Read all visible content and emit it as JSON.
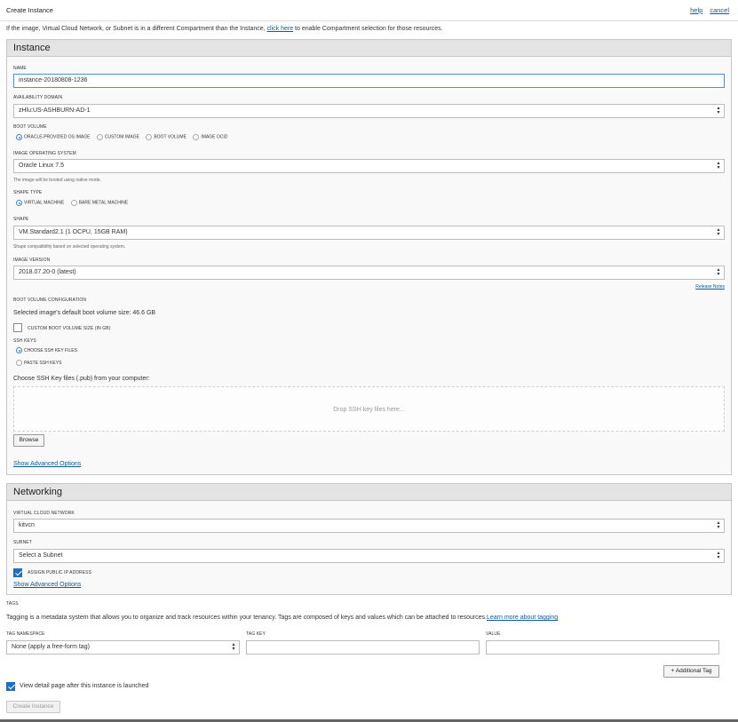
{
  "header": {
    "title": "Create Instance",
    "help_link": "help",
    "cancel_link": "cancel"
  },
  "notice": {
    "before": "If the image, Virtual Cloud Network, or Subnet is in a different Compartment than the Instance, ",
    "link": "click here",
    "after": " to enable Compartment selection for those resources."
  },
  "instance": {
    "heading": "Instance",
    "name_label": "NAME",
    "name_value": "instance-20180808-1236",
    "ad_label": "AVAILABILITY DOMAIN",
    "ad_value": "zHlu:US-ASHBURN-AD-1",
    "boot_volume_label": "BOOT VOLUME",
    "boot_volume_options": [
      "ORACLE-PROVIDED OS IMAGE",
      "CUSTOM IMAGE",
      "BOOT VOLUME",
      "IMAGE OCID"
    ],
    "boot_volume_selected": "ORACLE-PROVIDED OS IMAGE",
    "os_label": "IMAGE OPERATING SYSTEM",
    "os_value": "Oracle Linux 7.5",
    "os_help": "The image will be booted using native mode.",
    "shape_type_label": "SHAPE TYPE",
    "shape_type_options": [
      "VIRTUAL MACHINE",
      "BARE METAL MACHINE"
    ],
    "shape_type_selected": "VIRTUAL MACHINE",
    "shape_label": "SHAPE",
    "shape_value": "VM.Standard2.1 (1 OCPU, 15GB RAM)",
    "shape_help": "Shape compatibility based on selected operating system.",
    "image_version_label": "IMAGE VERSION",
    "image_version_value": "2018.07.20-0 (latest)",
    "release_notes_link": "Release Notes",
    "boot_config_label": "BOOT VOLUME CONFIGURATION",
    "boot_size_text": "Selected image's default boot volume size: 46.6 GB",
    "custom_boot_size_label": "CUSTOM BOOT VOLUME SIZE (IN GB)",
    "ssh_keys_label": "SSH KEYS",
    "ssh_options": [
      "CHOOSE SSH KEY FILES",
      "PASTE SSH KEYS"
    ],
    "ssh_selected": "CHOOSE SSH KEY FILES",
    "ssh_choose_text": "Choose SSH Key files (.pub) from your computer:",
    "drop_text": "Drop SSH key files here...",
    "browse_button": "Browse",
    "advanced_link": "Show Advanced Options"
  },
  "networking": {
    "heading": "Networking",
    "vcn_label": "VIRTUAL CLOUD NETWORK",
    "vcn_value": "kitvcn",
    "subnet_label": "SUBNET",
    "subnet_value": "Select a Subnet",
    "assign_ip_label": "ASSIGN PUBLIC IP ADDRESS",
    "assign_ip_checked": true,
    "advanced_link": "Show Advanced Options"
  },
  "tags": {
    "heading": "TAGS",
    "description": "Tagging is a metadata system that allows you to organize and track resources within your tenancy. Tags are composed of keys and values which can be attached to resources.",
    "learn_more_link": "Learn more about tagging",
    "namespace_label": "TAG NAMESPACE",
    "namespace_value": "None (apply a free-form tag)",
    "key_label": "TAG KEY",
    "key_value": "",
    "value_label": "VALUE",
    "value_value": "",
    "add_tag_button": "+ Additional Tag"
  },
  "footer": {
    "view_detail_label": "View detail page after this instance is launched",
    "view_detail_checked": true,
    "create_button": "Create Instance"
  },
  "colors": {
    "link": "#0f5a9c",
    "accent": "#1e6fc2",
    "panel_header": "#e4e4e4"
  }
}
